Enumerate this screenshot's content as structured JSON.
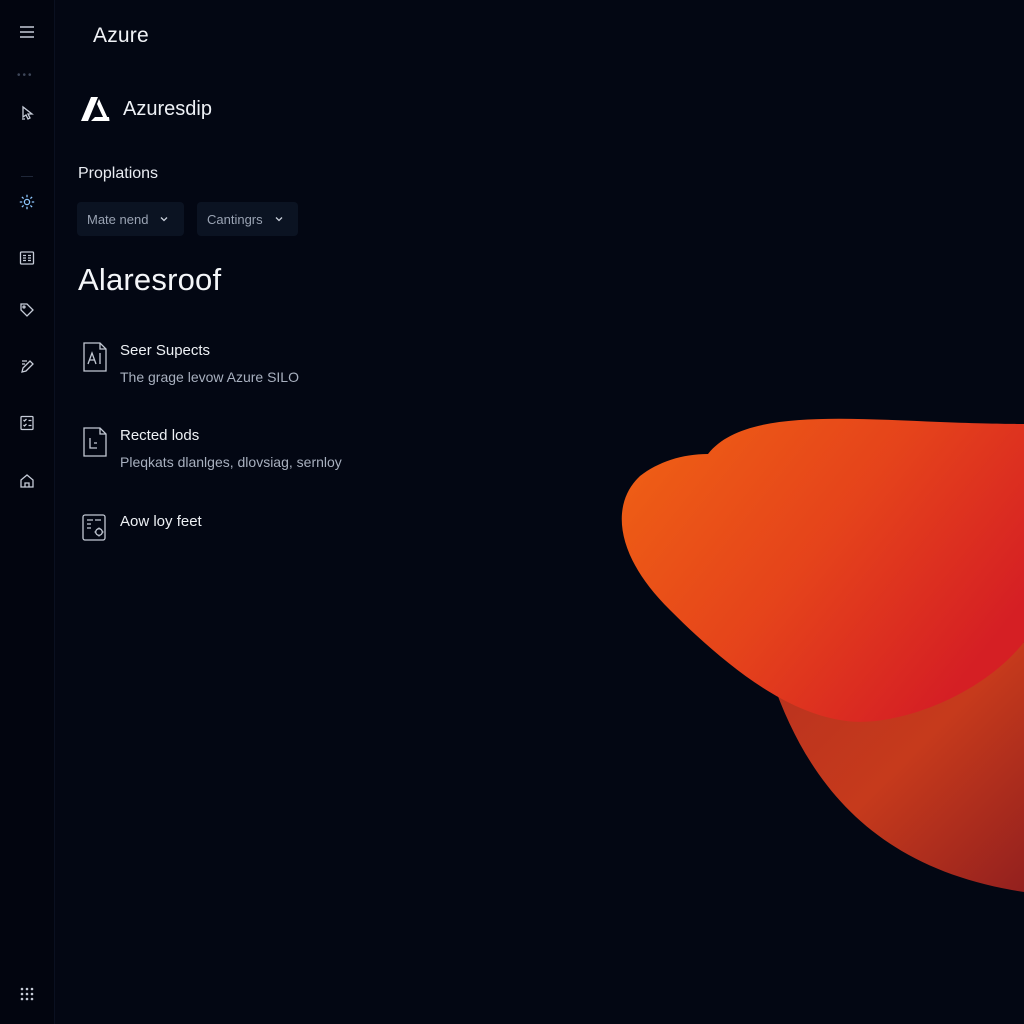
{
  "app": {
    "title": "Azure"
  },
  "brand": {
    "name": "Azuresdip"
  },
  "section": {
    "label": "Proplations"
  },
  "filters": [
    {
      "label": "Mate nend"
    },
    {
      "label": "Cantingrs"
    }
  ],
  "page": {
    "title": "Alaresroof"
  },
  "items": [
    {
      "title": "Seer Supects",
      "description": "The grage levow Azure SILO",
      "icon": "document-a-icon"
    },
    {
      "title": "Rected lods",
      "description": "Pleqkats dlanlges, dlovsiag, sernloy",
      "icon": "document-b-icon"
    },
    {
      "title": "Aow loy feet",
      "description": "",
      "icon": "document-settings-icon"
    }
  ],
  "rail": {
    "items": [
      "menu-icon",
      "pointer-icon",
      "settings-icon",
      "list-icon",
      "tag-icon",
      "document-edit-icon",
      "checklist-icon",
      "home-icon",
      "grid-icon"
    ],
    "active": "settings-icon"
  },
  "colors": {
    "background": "#030713",
    "accent_active": "#8ec8ff",
    "shape_orange": "#f26014",
    "shape_red": "#d9251e"
  }
}
